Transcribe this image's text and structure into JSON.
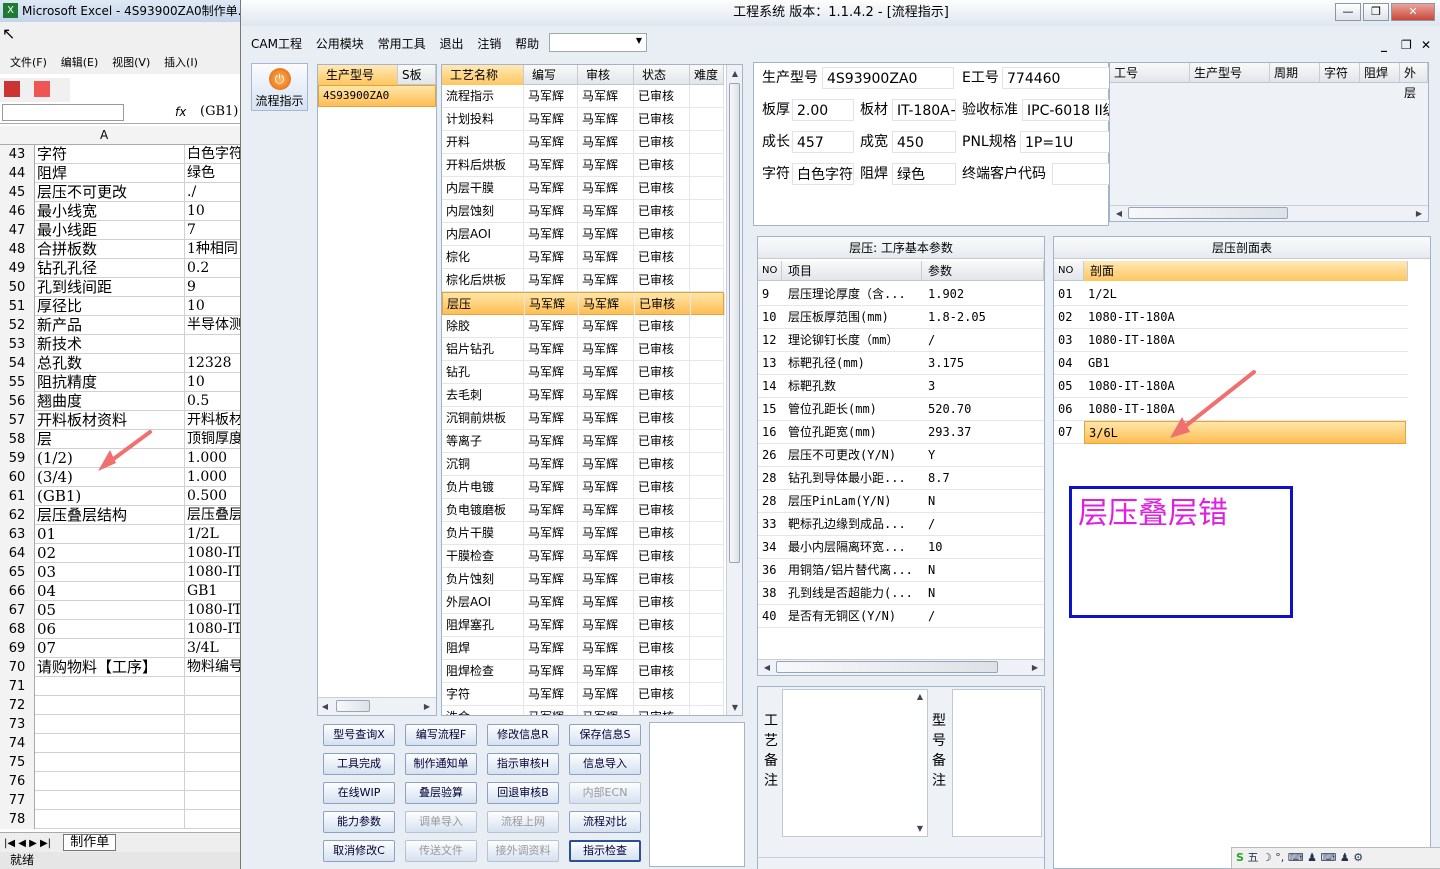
{
  "excel": {
    "title": "Microsoft Excel - 4S93900ZA0制作单.x",
    "menu": [
      "文件(F)",
      "编辑(E)",
      "视图(V)",
      "插入(I)"
    ],
    "fx_label": "fx",
    "fx_value": "(GB1)",
    "col_header": "A",
    "rows": [
      {
        "n": "43",
        "a": "字符",
        "b": "白色字符"
      },
      {
        "n": "44",
        "a": "阻焊",
        "b": "绿色"
      },
      {
        "n": "45",
        "a": "层压不可更改",
        "b": "./"
      },
      {
        "n": "46",
        "a": "最小线宽",
        "b": "10"
      },
      {
        "n": "47",
        "a": "最小线距",
        "b": "7"
      },
      {
        "n": "48",
        "a": "合拼板数",
        "b": "1种相同"
      },
      {
        "n": "49",
        "a": "钻孔孔径",
        "b": "0.2"
      },
      {
        "n": "50",
        "a": "孔到线间距",
        "b": "9"
      },
      {
        "n": "51",
        "a": "厚径比",
        "b": "10"
      },
      {
        "n": "52",
        "a": "新产品",
        "b": "半导体测"
      },
      {
        "n": "53",
        "a": "新技术",
        "b": ""
      },
      {
        "n": "54",
        "a": "总孔数",
        "b": "12328"
      },
      {
        "n": "55",
        "a": "阻抗精度",
        "b": "10"
      },
      {
        "n": "56",
        "a": "翘曲度",
        "b": "0.5"
      },
      {
        "n": "57",
        "a": "开料板材资料",
        "b": "开料板材"
      },
      {
        "n": "58",
        "a": "层",
        "b": "顶铜厚度"
      },
      {
        "n": "59",
        "a": "(1/2)",
        "b": "1.000"
      },
      {
        "n": "60",
        "a": "(3/4)",
        "b": "1.000"
      },
      {
        "n": "61",
        "a": "(GB1)",
        "b": "0.500"
      },
      {
        "n": "62",
        "a": "层压叠层结构",
        "b": "层压叠层"
      },
      {
        "n": "63",
        "a": "01",
        "b": "1/2L"
      },
      {
        "n": "64",
        "a": "02",
        "b": "1080-IT"
      },
      {
        "n": "65",
        "a": "03",
        "b": "1080-IT"
      },
      {
        "n": "66",
        "a": "04",
        "b": "GB1"
      },
      {
        "n": "67",
        "a": "05",
        "b": "1080-IT"
      },
      {
        "n": "68",
        "a": "06",
        "b": "1080-IT"
      },
      {
        "n": "69",
        "a": "07",
        "b": "3/4L"
      },
      {
        "n": "70",
        "a": "请购物料【工序】",
        "b": "物料编号"
      },
      {
        "n": "71",
        "a": "",
        "b": ""
      },
      {
        "n": "72",
        "a": "",
        "b": ""
      },
      {
        "n": "73",
        "a": "",
        "b": ""
      },
      {
        "n": "74",
        "a": "",
        "b": ""
      },
      {
        "n": "75",
        "a": "",
        "b": ""
      },
      {
        "n": "76",
        "a": "",
        "b": ""
      },
      {
        "n": "77",
        "a": "",
        "b": ""
      },
      {
        "n": "78",
        "a": "",
        "b": ""
      }
    ],
    "sheet_tab": "制作单",
    "status": "就绪"
  },
  "app": {
    "title": "工程系统  版本：1.1.4.2 - [流程指示]",
    "menu": [
      "CAM工程",
      "公用模块",
      "常用工具",
      "退出",
      "注销",
      "帮助"
    ],
    "tool_label": "流程指示",
    "model_list": {
      "headers": [
        "生产型号",
        "S板"
      ],
      "items": [
        "4S93900ZA0"
      ]
    },
    "process": {
      "headers": [
        "工艺名称",
        "编写",
        "审核",
        "状态",
        "难度"
      ],
      "rows": [
        [
          "流程指示",
          "马军辉",
          "马军辉",
          "已审核"
        ],
        [
          "计划投料",
          "马军辉",
          "马军辉",
          "已审核"
        ],
        [
          "开料",
          "马军辉",
          "马军辉",
          "已审核"
        ],
        [
          "开料后烘板",
          "马军辉",
          "马军辉",
          "已审核"
        ],
        [
          "内层干膜",
          "马军辉",
          "马军辉",
          "已审核"
        ],
        [
          "内层蚀刻",
          "马军辉",
          "马军辉",
          "已审核"
        ],
        [
          "内层AOI",
          "马军辉",
          "马军辉",
          "已审核"
        ],
        [
          "棕化",
          "马军辉",
          "马军辉",
          "已审核"
        ],
        [
          "棕化后烘板",
          "马军辉",
          "马军辉",
          "已审核"
        ],
        [
          "层压",
          "马军辉",
          "马军辉",
          "已审核"
        ],
        [
          "除胶",
          "马军辉",
          "马军辉",
          "已审核"
        ],
        [
          "铝片钻孔",
          "马军辉",
          "马军辉",
          "已审核"
        ],
        [
          "钻孔",
          "马军辉",
          "马军辉",
          "已审核"
        ],
        [
          "去毛刺",
          "马军辉",
          "马军辉",
          "已审核"
        ],
        [
          "沉铜前烘板",
          "马军辉",
          "马军辉",
          "已审核"
        ],
        [
          "等离子",
          "马军辉",
          "马军辉",
          "已审核"
        ],
        [
          "沉铜",
          "马军辉",
          "马军辉",
          "已审核"
        ],
        [
          "负片电镀",
          "马军辉",
          "马军辉",
          "已审核"
        ],
        [
          "负电镀磨板",
          "马军辉",
          "马军辉",
          "已审核"
        ],
        [
          "负片干膜",
          "马军辉",
          "马军辉",
          "已审核"
        ],
        [
          "干膜检查",
          "马军辉",
          "马军辉",
          "已审核"
        ],
        [
          "负片蚀刻",
          "马军辉",
          "马军辉",
          "已审核"
        ],
        [
          "外层AOI",
          "马军辉",
          "马军辉",
          "已审核"
        ],
        [
          "阻焊塞孔",
          "马军辉",
          "马军辉",
          "已审核"
        ],
        [
          "阻焊",
          "马军辉",
          "马军辉",
          "已审核"
        ],
        [
          "阻焊检查",
          "马军辉",
          "马军辉",
          "已审核"
        ],
        [
          "字符",
          "马军辉",
          "马军辉",
          "已审核"
        ],
        [
          "洗金",
          "马军辉",
          "马军辉",
          "已审核"
        ]
      ],
      "selected_index": 9
    },
    "buttons": [
      [
        "型号查询X",
        "编写流程F",
        "修改信息R",
        "保存信息S"
      ],
      [
        "工具完成",
        "制作通知单",
        "指示审核H",
        "信息导入"
      ],
      [
        "在线WIP",
        "叠层验算",
        "回退审核B",
        "内部ECN"
      ],
      [
        "能力参数",
        "调单导入",
        "流程上网",
        "流程对比"
      ],
      [
        "取消修改C",
        "传送文件",
        "接外调资料",
        "指示检查"
      ]
    ],
    "info": {
      "model_label": "生产型号",
      "model": "4S93900ZA0",
      "e_label": "E工号",
      "e_no": "774460",
      "thick_label": "板厚",
      "thick": "2.00",
      "mat_label": "板材",
      "mat": "IT-180A+",
      "std_label": "验收标准",
      "std": "IPC-6018 II级",
      "len_label": "成长",
      "len": "457",
      "wid_label": "成宽",
      "wid": "450",
      "pnl_label": "PNL规格",
      "pnl": "1P=1U",
      "char_label": "字符",
      "char": "白色字符",
      "mask_label": "阻焊",
      "mask": "绿色",
      "cust_label": "终端客户代码",
      "cust": ""
    },
    "right_grid_headers": [
      "工号",
      "生产型号",
      "周期",
      "字符",
      "阻焊",
      "外层"
    ],
    "params": {
      "title": "层压: 工序基本参数",
      "headers": [
        "NO",
        "项目",
        "参数"
      ],
      "rows": [
        [
          "9",
          "层压理论厚度（含...",
          "1.902"
        ],
        [
          "10",
          "层压板厚范围(mm)",
          "1.8-2.05"
        ],
        [
          "12",
          "理论铆钉长度（mm）",
          "/"
        ],
        [
          "13",
          "标靶孔径(mm)",
          "3.175"
        ],
        [
          "14",
          "标靶孔数",
          "3"
        ],
        [
          "15",
          "管位孔距长(mm)",
          "520.70"
        ],
        [
          "16",
          "管位孔距宽(mm)",
          "293.37"
        ],
        [
          "26",
          "层压不可更改(Y/N)",
          "Y"
        ],
        [
          "28",
          "钻孔到导体最小距...",
          "8.7"
        ],
        [
          "28",
          "层压PinLam(Y/N)",
          "N"
        ],
        [
          "33",
          "靶标孔边缘到成品...",
          "/"
        ],
        [
          "34",
          "最小内层隔离环宽...",
          "10"
        ],
        [
          "36",
          "用铜箔/铝片替代离...",
          "N"
        ],
        [
          "38",
          "孔到线是否超能力(...",
          "N"
        ],
        [
          "40",
          "是否有无铜区(Y/N)",
          "/"
        ]
      ]
    },
    "stack": {
      "title": "层压剖面表",
      "headers": [
        "NO",
        "剖面"
      ],
      "rows": [
        [
          "01",
          "1/2L"
        ],
        [
          "02",
          "1080-IT-180A"
        ],
        [
          "03",
          "1080-IT-180A"
        ],
        [
          "04",
          "GB1"
        ],
        [
          "05",
          "1080-IT-180A"
        ],
        [
          "06",
          "1080-IT-180A"
        ],
        [
          "07",
          "3/6L"
        ]
      ],
      "selected_index": 6
    },
    "annotation": "层压叠层错",
    "remark_process": "工艺备注",
    "remark_model": "型号备注",
    "tray": "五 ☽ °, ⌨ ♟ ⌨ ♟ ⚙"
  },
  "colors": {
    "annotation_border": "#1010cc",
    "annotation_text": "#e020e0",
    "arrow": "#f07070",
    "selection": "#ffc660"
  }
}
